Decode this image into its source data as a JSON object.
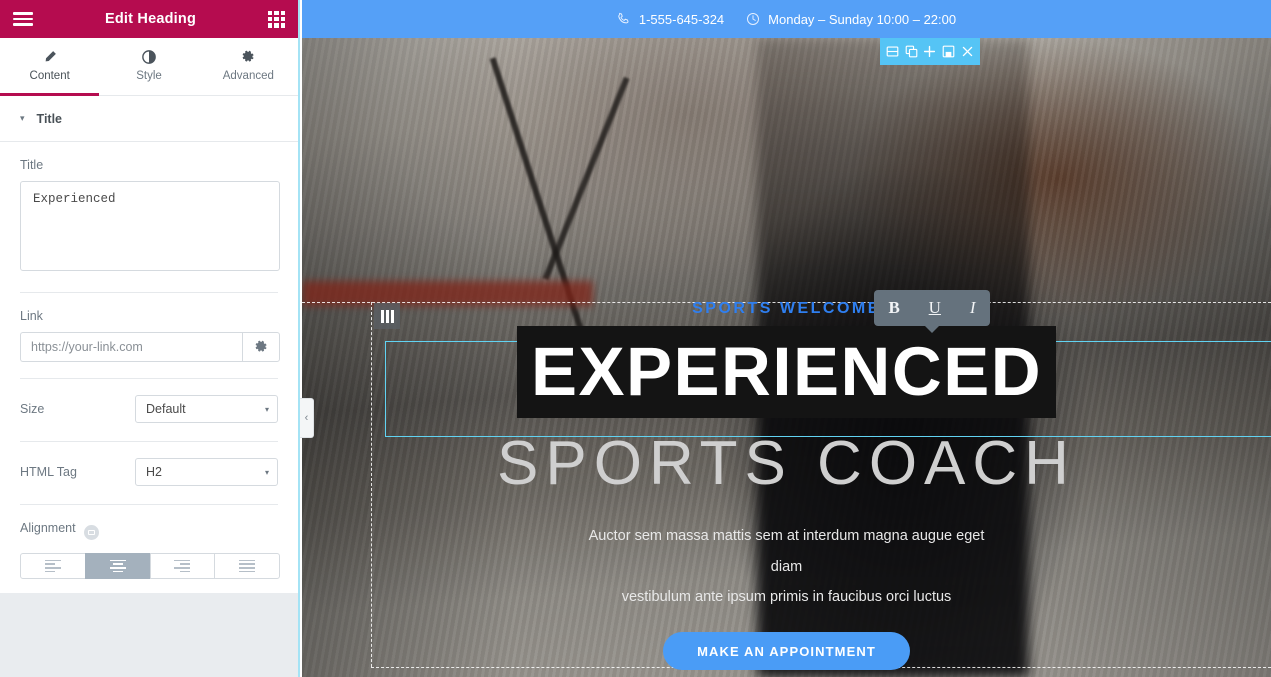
{
  "panel": {
    "header": {
      "title": "Edit Heading",
      "menu_icon": "hamburger-icon",
      "widgets_icon": "grid-icon"
    },
    "tabs": [
      {
        "label": "Content",
        "icon": "pencil-icon",
        "active": true
      },
      {
        "label": "Style",
        "icon": "contrast-icon",
        "active": false
      },
      {
        "label": "Advanced",
        "icon": "gear-icon",
        "active": false
      }
    ],
    "section": {
      "label": "Title",
      "caret": "▾"
    },
    "fields": {
      "title": {
        "label": "Title",
        "value": "Experienced"
      },
      "link": {
        "label": "Link",
        "value": "",
        "placeholder": "https://your-link.com",
        "gear_icon": "gear-icon"
      },
      "size": {
        "label": "Size",
        "value": "Default",
        "arrow": "▾"
      },
      "html_tag": {
        "label": "HTML Tag",
        "value": "H2",
        "arrow": "▾"
      },
      "alignment": {
        "label": "Alignment",
        "responsive_icon": "device-icon",
        "options": [
          "align-left",
          "align-center",
          "align-right",
          "align-justify"
        ],
        "selected_index": 1
      }
    },
    "collapse_tab": {
      "icon": "chevron-left-icon",
      "glyph": "‹"
    }
  },
  "canvas": {
    "topbar": {
      "phone_icon": "phone-icon",
      "phone": "1-555-645-324",
      "clock_icon": "clock-icon",
      "hours": "Monday – Sunday 10:00 – 22:00"
    },
    "section_toolbar": {
      "items": [
        {
          "name": "edit-section-icon",
          "glyph": "columns"
        },
        {
          "name": "duplicate-section-icon",
          "glyph": "copy"
        },
        {
          "name": "add-section-icon",
          "glyph": "+"
        },
        {
          "name": "save-section-icon",
          "glyph": "save"
        },
        {
          "name": "delete-section-icon",
          "glyph": "×"
        }
      ]
    },
    "column_handle_icon": "columns-icon",
    "hero": {
      "eyebrow": "SPORTS WELCOME",
      "headline": "EXPERIENCED",
      "subheadline": "SPORTS COACH",
      "lede_line1": "Auctor sem massa mattis sem at interdum magna augue eget diam",
      "lede_line2": "vestibulum ante ipsum primis in faucibus orci luctus",
      "cta_label": "MAKE AN APPOINTMENT"
    },
    "text_toolbar": {
      "bold": "B",
      "underline": "U",
      "italic": "I"
    }
  },
  "colors": {
    "panel_header": "#b50c4f",
    "topbar_blue": "#55a0f7",
    "section_toolbar_blue": "#55c4f5",
    "selection_outline": "#61d3f2",
    "cta_blue": "#4a9cf6",
    "eyebrow_blue": "#2f7ff0"
  }
}
